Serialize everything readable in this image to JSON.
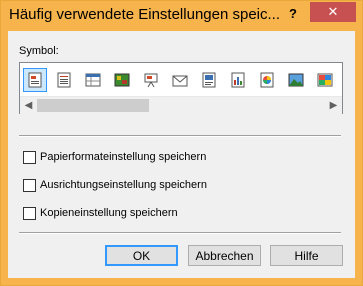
{
  "window": {
    "title": "Häufig verwendete Einstellungen speic...",
    "help_glyph": "?",
    "close_glyph": "✕"
  },
  "symbol": {
    "label": "Symbol:",
    "icons": [
      "document-text-icon",
      "document-lines-icon",
      "document-table-icon",
      "photo-pattern-icon",
      "presentation-easel-icon",
      "envelope-icon",
      "document-image-icon",
      "document-chart-icon",
      "color-wheel-icon",
      "landscape-photo-icon",
      "color-palette-icon"
    ],
    "selected_index": 0
  },
  "scrollbar": {
    "left_arrow": "◀",
    "right_arrow": "▶"
  },
  "options": [
    {
      "label": "Papierformateinstellung speichern",
      "checked": false
    },
    {
      "label": "Ausrichtungseinstellung speichern",
      "checked": false
    },
    {
      "label": "Kopieneinstellung speichern",
      "checked": false
    }
  ],
  "buttons": {
    "ok": "OK",
    "cancel": "Abbrechen",
    "help": "Hilfe"
  },
  "colors": {
    "titlebar": "#f7b44c",
    "close": "#c75050",
    "selection": "#cce8ff"
  }
}
